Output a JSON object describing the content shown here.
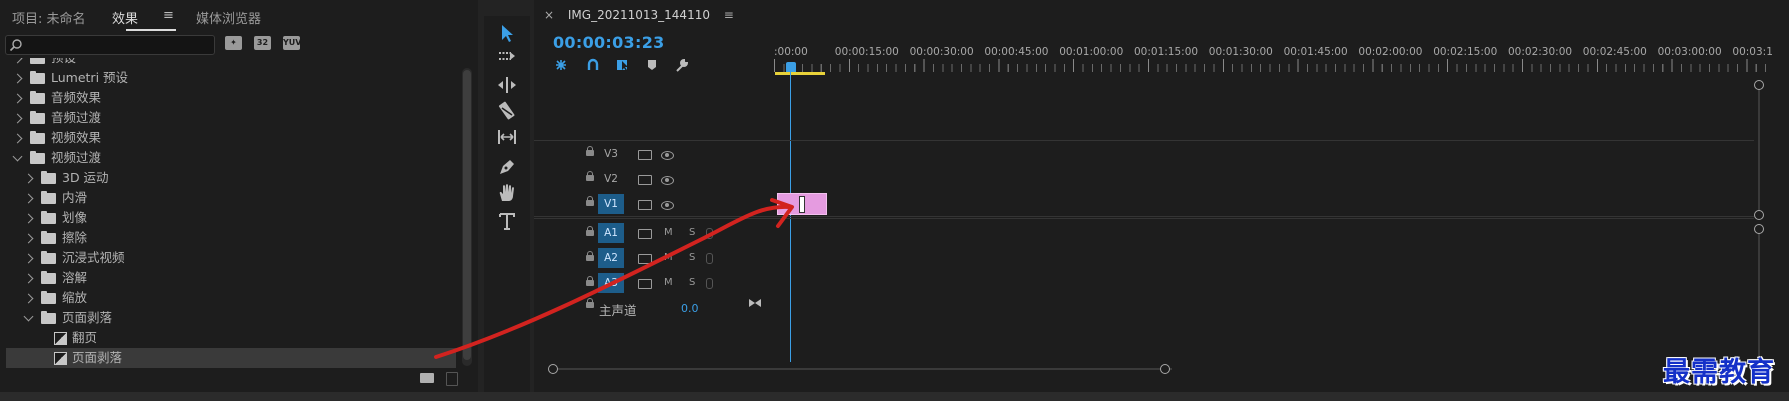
{
  "project_panel": {
    "tabs": [
      "项目: 未命名",
      "效果",
      "媒体浏览器"
    ],
    "active_tab_index": 1,
    "search_placeholder": "",
    "filter_buttons": [
      "accelerated",
      "32",
      "YUV"
    ],
    "tree": [
      {
        "label": "预设",
        "level": 0,
        "expanded": false,
        "icon": "folder-icon"
      },
      {
        "label": "Lumetri 预设",
        "level": 0,
        "expanded": false,
        "icon": "folder-icon"
      },
      {
        "label": "音频效果",
        "level": 0,
        "expanded": false,
        "icon": "folder-icon"
      },
      {
        "label": "音频过渡",
        "level": 0,
        "expanded": false,
        "icon": "folder-icon"
      },
      {
        "label": "视频效果",
        "level": 0,
        "expanded": false,
        "icon": "folder-icon"
      },
      {
        "label": "视频过渡",
        "level": 0,
        "expanded": true,
        "icon": "folder-icon"
      },
      {
        "label": "3D 运动",
        "level": 1,
        "expanded": false,
        "icon": "folder-icon"
      },
      {
        "label": "内滑",
        "level": 1,
        "expanded": false,
        "icon": "folder-icon"
      },
      {
        "label": "划像",
        "level": 1,
        "expanded": false,
        "icon": "folder-icon"
      },
      {
        "label": "擦除",
        "level": 1,
        "expanded": false,
        "icon": "folder-icon"
      },
      {
        "label": "沉浸式视频",
        "level": 1,
        "expanded": false,
        "icon": "folder-icon"
      },
      {
        "label": "溶解",
        "level": 1,
        "expanded": false,
        "icon": "folder-icon"
      },
      {
        "label": "缩放",
        "level": 1,
        "expanded": false,
        "icon": "folder-icon"
      },
      {
        "label": "页面剥落",
        "level": 1,
        "expanded": true,
        "icon": "folder-icon"
      },
      {
        "label": "翻页",
        "level": 2,
        "icon": "transition-icon"
      },
      {
        "label": "页面剥落",
        "level": 2,
        "icon": "transition-icon",
        "selected": true
      }
    ]
  },
  "tools": [
    "selection-tool-icon",
    "track-select-tool-icon",
    "ripple-edit-tool-icon",
    "razor-tool-icon",
    "slip-tool-icon",
    "pen-tool-icon",
    "hand-tool-icon",
    "type-tool-icon"
  ],
  "timeline": {
    "sequence_name": "IMG_20211013_144110",
    "close_glyph": "×",
    "menu_glyph": "≡",
    "timecode": "00:00:03:23",
    "ruler_labels": [
      ":00:00",
      "00:00:15:00",
      "00:00:30:00",
      "00:00:45:00",
      "00:01:00:00",
      "00:01:15:00",
      "00:01:30:00",
      "00:01:45:00",
      "00:02:00:00",
      "00:02:15:00",
      "00:02:30:00",
      "00:02:45:00",
      "00:03:00:00",
      "00:03:1"
    ],
    "video_tracks": [
      "V3",
      "V2",
      "V1"
    ],
    "audio_tracks": [
      "A1",
      "A2",
      "A3"
    ],
    "mute_label": "M",
    "solo_label": "S",
    "master_label": "主声道",
    "master_value": "0.0"
  },
  "watermark": "最需教育",
  "colors": {
    "accent_blue": "#3b9fe6",
    "clip_pink": "#e59be0",
    "work_area_yellow": "#e8d23a",
    "annotation_red": "#d2231f"
  }
}
